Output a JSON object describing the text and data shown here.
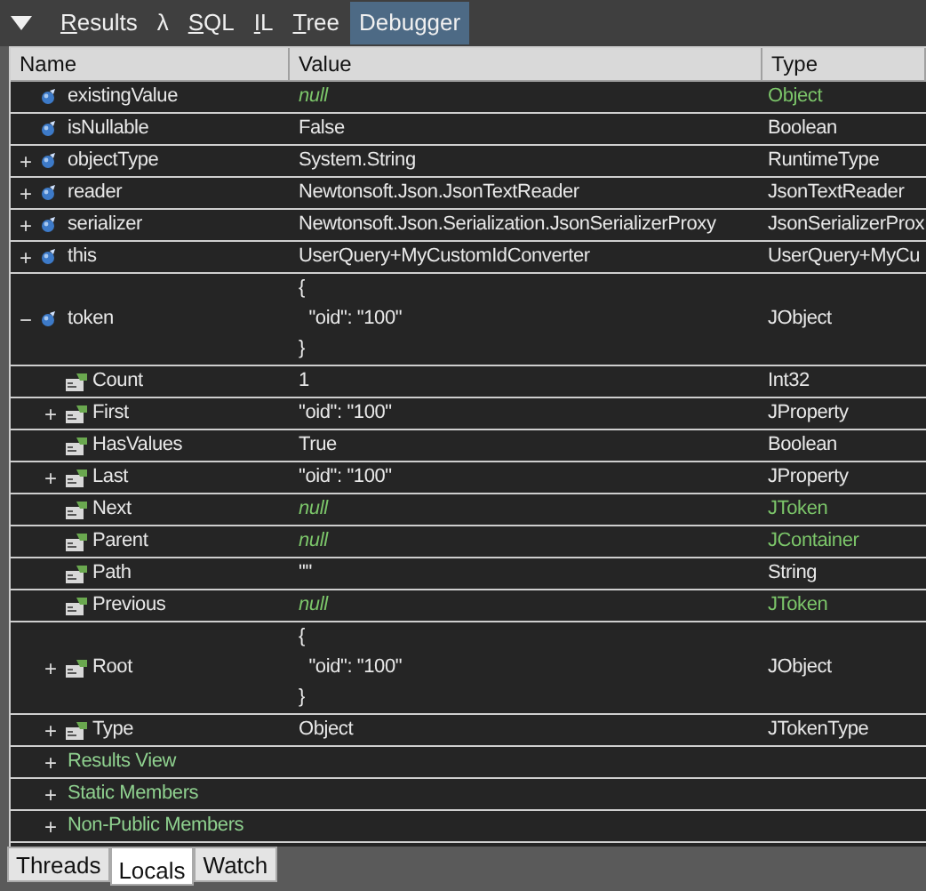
{
  "toolbar": {
    "tabs": [
      {
        "label": "Results",
        "underline_first": true,
        "selected": false
      },
      {
        "label": "λ",
        "underline_first": false,
        "selected": false
      },
      {
        "label": "SQL",
        "underline_first": true,
        "selected": false
      },
      {
        "label": "IL",
        "underline_first": true,
        "selected": false
      },
      {
        "label": "Tree",
        "underline_first": true,
        "selected": false
      },
      {
        "label": "Debugger",
        "underline_first": false,
        "selected": true
      }
    ]
  },
  "table": {
    "columns": [
      "Name",
      "Value",
      "Type"
    ],
    "rows": [
      {
        "kind": "field",
        "name": "existingValue",
        "value": "null",
        "type": "Object",
        "null_value": true,
        "type_highlight": true
      },
      {
        "kind": "field",
        "name": "isNullable",
        "value": "False",
        "type": "Boolean",
        "null_value": false,
        "type_highlight": false
      },
      {
        "kind": "field",
        "toggle": "+",
        "name": "objectType",
        "value": "System.String",
        "type": "RuntimeType",
        "null_value": false,
        "type_highlight": false
      },
      {
        "kind": "field",
        "toggle": "+",
        "name": "reader",
        "value": "Newtonsoft.Json.JsonTextReader",
        "type": "JsonTextReader",
        "null_value": false,
        "type_highlight": false
      },
      {
        "kind": "field",
        "toggle": "+",
        "name": "serializer",
        "value": "Newtonsoft.Json.Serialization.JsonSerializerProxy",
        "type": "JsonSerializerProx",
        "null_value": false,
        "type_highlight": false
      },
      {
        "kind": "field",
        "toggle": "+",
        "name": "this",
        "value": "UserQuery+MyCustomIdConverter",
        "type": "UserQuery+MyCu",
        "null_value": false,
        "type_highlight": false
      },
      {
        "kind": "field",
        "toggle": "−",
        "name": "token",
        "value": "{\n  \"oid\": \"100\"\n}",
        "type": "JObject",
        "null_value": false,
        "type_highlight": false,
        "children": [
          {
            "kind": "property",
            "name": "Count",
            "value": "1",
            "type": "Int32",
            "null_value": false,
            "type_highlight": false
          },
          {
            "kind": "property",
            "toggle": "+",
            "name": "First",
            "value": "\"oid\": \"100\"",
            "type": "JProperty",
            "null_value": false,
            "type_highlight": false
          },
          {
            "kind": "property",
            "name": "HasValues",
            "value": "True",
            "type": "Boolean",
            "null_value": false,
            "type_highlight": false
          },
          {
            "kind": "property",
            "toggle": "+",
            "name": "Last",
            "value": "\"oid\": \"100\"",
            "type": "JProperty",
            "null_value": false,
            "type_highlight": false
          },
          {
            "kind": "property",
            "name": "Next",
            "value": "null",
            "type": "JToken",
            "null_value": true,
            "type_highlight": true
          },
          {
            "kind": "property",
            "name": "Parent",
            "value": "null",
            "type": "JContainer",
            "null_value": true,
            "type_highlight": true
          },
          {
            "kind": "property",
            "name": "Path",
            "value": "\"\"",
            "type": "String",
            "null_value": false,
            "type_highlight": false
          },
          {
            "kind": "property",
            "name": "Previous",
            "value": "null",
            "type": "JToken",
            "null_value": true,
            "type_highlight": true
          },
          {
            "kind": "property",
            "toggle": "+",
            "name": "Root",
            "value": "{\n  \"oid\": \"100\"\n}",
            "type": "JObject",
            "null_value": false,
            "type_highlight": false
          },
          {
            "kind": "property",
            "toggle": "+",
            "name": "Type",
            "value": "Object",
            "type": "JTokenType",
            "null_value": false,
            "type_highlight": false
          },
          {
            "kind": "group",
            "toggle": "+",
            "name": "Results View"
          },
          {
            "kind": "group",
            "toggle": "+",
            "name": "Static Members"
          },
          {
            "kind": "group",
            "toggle": "+",
            "name": "Non-Public Members"
          }
        ]
      }
    ]
  },
  "bottom_tabs": [
    {
      "label": "Threads",
      "selected": false
    },
    {
      "label": "Locals",
      "selected": true
    },
    {
      "label": "Watch",
      "selected": false
    }
  ]
}
